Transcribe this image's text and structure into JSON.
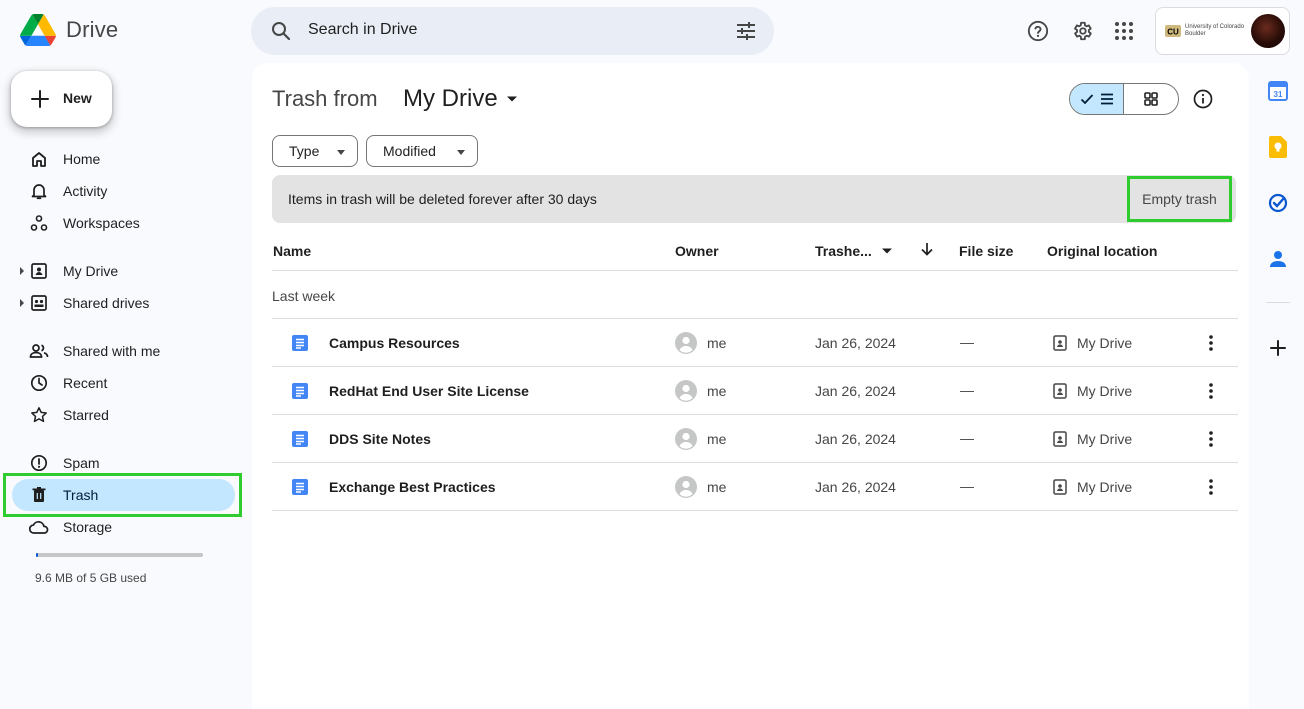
{
  "app": {
    "name": "Drive"
  },
  "search": {
    "placeholder": "Search in Drive"
  },
  "account": {
    "org_name": "University of Colorado Boulder"
  },
  "new_button": {
    "label": "New"
  },
  "sidebar": {
    "items": [
      {
        "label": "Home",
        "icon": "home-icon"
      },
      {
        "label": "Activity",
        "icon": "bell-icon"
      },
      {
        "label": "Workspaces",
        "icon": "workspaces-icon"
      },
      {
        "label": "My Drive",
        "icon": "my-drive-icon"
      },
      {
        "label": "Shared drives",
        "icon": "shared-drives-icon"
      },
      {
        "label": "Shared with me",
        "icon": "people-icon"
      },
      {
        "label": "Recent",
        "icon": "clock-icon"
      },
      {
        "label": "Starred",
        "icon": "star-icon"
      },
      {
        "label": "Spam",
        "icon": "spam-icon"
      },
      {
        "label": "Trash",
        "icon": "trash-icon",
        "active": true
      },
      {
        "label": "Storage",
        "icon": "cloud-icon"
      }
    ],
    "storage": {
      "used_text": "9.6 MB of 5 GB used",
      "used_fraction": 0.002
    }
  },
  "main": {
    "title_prefix": "Trash from",
    "title_location": "My Drive",
    "filters": {
      "type": "Type",
      "modified": "Modified"
    },
    "banner": {
      "message": "Items in trash will be deleted forever after 30 days",
      "action": "Empty trash"
    },
    "columns": {
      "name": "Name",
      "owner": "Owner",
      "trashed": "Trashe...",
      "file_size": "File size",
      "original_location": "Original location"
    },
    "group_label": "Last week",
    "files": [
      {
        "name": "Campus Resources",
        "owner": "me",
        "trashed": "Jan 26, 2024",
        "size": "—",
        "location": "My Drive"
      },
      {
        "name": "RedHat End User Site License",
        "owner": "me",
        "trashed": "Jan 26, 2024",
        "size": "—",
        "location": "My Drive"
      },
      {
        "name": "DDS Site Notes",
        "owner": "me",
        "trashed": "Jan 26, 2024",
        "size": "—",
        "location": "My Drive"
      },
      {
        "name": "Exchange Best Practices",
        "owner": "me",
        "trashed": "Jan 26, 2024",
        "size": "—",
        "location": "My Drive"
      }
    ]
  },
  "colors": {
    "accent": "#0b57d0",
    "active_nav": "#c2e7ff",
    "highlight_border": "#2ecc2e",
    "doc_blue": "#4285f4"
  }
}
